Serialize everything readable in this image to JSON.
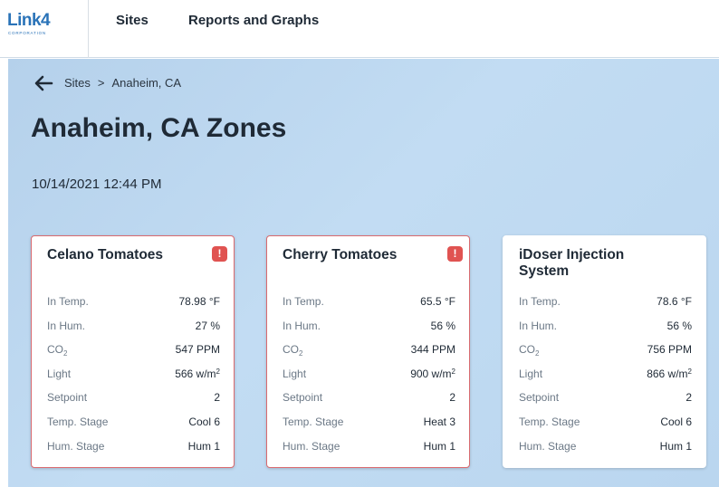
{
  "logo": {
    "main": "Link4",
    "sub": "CORPORATION"
  },
  "nav": {
    "sites": "Sites",
    "reports": "Reports and Graphs"
  },
  "breadcrumb": {
    "root": "Sites",
    "separator": ">",
    "current": "Anaheim, CA"
  },
  "page": {
    "title": "Anaheim, CA Zones",
    "datetime": "10/14/2021 12:44 PM"
  },
  "labels": {
    "in_temp": "In Temp.",
    "in_hum": "In Hum.",
    "co2_main": "CO",
    "co2_sub": "2",
    "light": "Light",
    "setpoint": "Setpoint",
    "temp_stage": "Temp. Stage",
    "hum_stage": "Hum. Stage"
  },
  "zones": [
    {
      "name": "Celano Tomatoes",
      "alert": true,
      "alert_symbol": "!",
      "in_temp": "78.98 °F",
      "in_hum": "27 %",
      "co2": "547 PPM",
      "light_value": "566 w/m",
      "light_exp": "2",
      "setpoint": "2",
      "temp_stage": "Cool 6",
      "hum_stage": "Hum 1"
    },
    {
      "name": "Cherry Tomatoes",
      "alert": true,
      "alert_symbol": "!",
      "in_temp": "65.5 °F",
      "in_hum": "56 %",
      "co2": "344 PPM",
      "light_value": "900 w/m",
      "light_exp": "2",
      "setpoint": "2",
      "temp_stage": "Heat 3",
      "hum_stage": "Hum 1"
    },
    {
      "name": "iDoser Injection System",
      "alert": false,
      "in_temp": "78.6 °F",
      "in_hum": "56 %",
      "co2": "756 PPM",
      "light_value": "866 w/m",
      "light_exp": "2",
      "setpoint": "2",
      "temp_stage": "Cool 6",
      "hum_stage": "Hum 1"
    }
  ],
  "colors": {
    "brand": "#2a73b8",
    "alert": "#e05351",
    "alarm_border": "#d96a6f",
    "background": "#bad6ef"
  }
}
